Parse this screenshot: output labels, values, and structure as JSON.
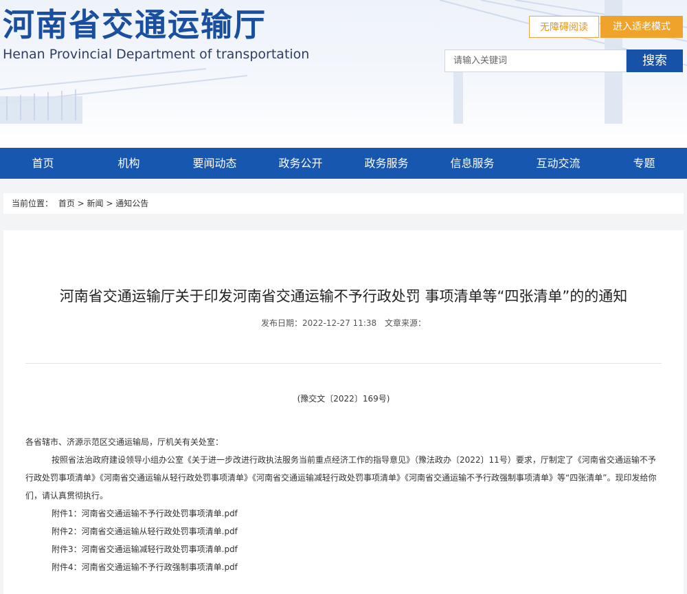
{
  "header": {
    "title": "河南省交通运输厅",
    "subtitle": "Henan Provincial Department of transportation",
    "accessible_label": "无障碍阅读",
    "elder_mode_label": "进入适老模式",
    "search_placeholder": "请输入关键词",
    "search_button": "搜索"
  },
  "nav": {
    "items": [
      "首页",
      "机构",
      "要闻动态",
      "政务公开",
      "政务服务",
      "信息服务",
      "互动交流",
      "专题"
    ]
  },
  "breadcrumb": {
    "prefix": "当前位置：",
    "path": "首页 > 新闻 > 通知公告"
  },
  "article": {
    "title": "河南省交通运输厅关于印发河南省交通运输不予行政处罚 事项清单等“四张清单”的的通知",
    "date_label": "发布日期：2022-12-27 11:38",
    "source_label": "文章来源：",
    "doc_number": "(豫交文〔2022〕169号)",
    "salutation": "各省辖市、济源示范区交通运输局，厅机关有关处室：",
    "paragraph": "按照省法治政府建设领导小组办公室《关于进一步改进行政执法服务当前重点经济工作的指导意见》（豫法政办〔2022〕11号）要求，厅制定了《河南省交通运输不予行政处罚事项清单》《河南省交通运输从轻行政处罚事项清单》《河南省交通运输减轻行政处罚事项清单》《河南省交通运输不予行政强制事项清单》等“四张清单”。现印发给你们，请认真贯彻执行。",
    "attachments": [
      "附件1：河南省交通运输不予行政处罚事项清单.pdf",
      "附件2：河南省交通运输从轻行政处罚事项清单.pdf",
      "附件3：河南省交通运输减轻行政处罚事项清单.pdf",
      "附件4：河南省交通运输不予行政强制事项清单.pdf"
    ]
  },
  "colors": {
    "brand_blue": "#1857b0",
    "title_blue": "#1a4fa0",
    "accent_orange": "#f0a32b"
  }
}
